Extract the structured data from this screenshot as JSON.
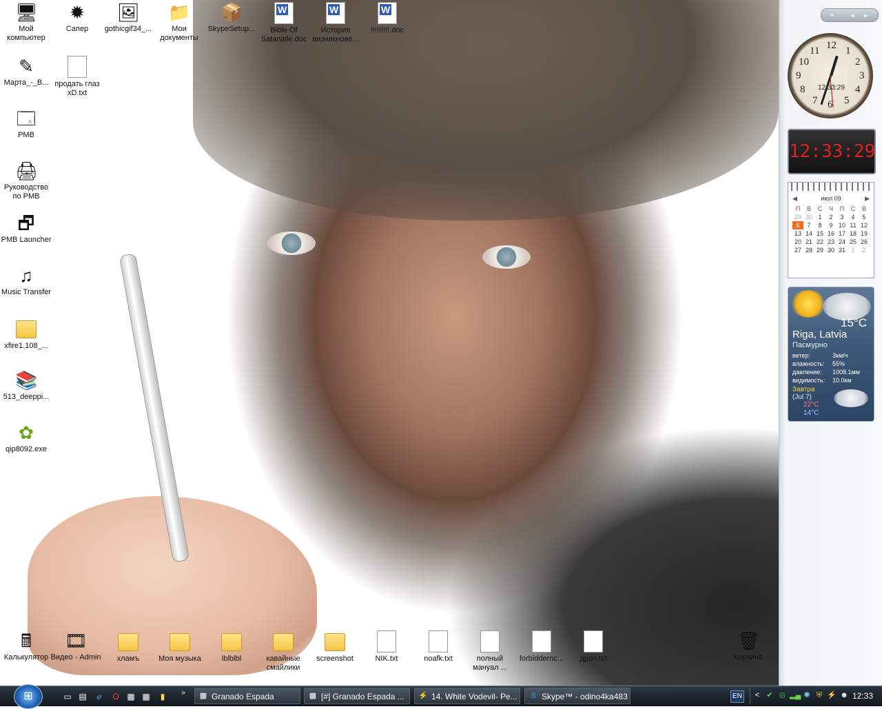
{
  "desktop": {
    "icons_top_row": [
      {
        "label": "Мой компьютер",
        "icon": "computer-icon"
      },
      {
        "label": "Сапер",
        "icon": "minesweeper-icon"
      },
      {
        "label": "gothicgif34_...",
        "icon": "image-file-icon"
      },
      {
        "label": "Мои документы",
        "icon": "documents-folder-icon"
      },
      {
        "label": "SkypeSetup...",
        "icon": "installer-icon"
      },
      {
        "label": "Bible Of Satanaile.doc",
        "icon": "word-doc-icon"
      },
      {
        "label": "История визникнове...",
        "icon": "word-doc-icon"
      },
      {
        "label": "!!!!!!!!!.doc",
        "icon": "word-doc-icon"
      }
    ],
    "icons_left_column": [
      {
        "label": "Марта_-_В...",
        "icon": "shortcut-icon"
      },
      {
        "label": "продать глаз xD.txt",
        "icon": "text-file-icon"
      },
      {
        "label": "PMB",
        "icon": "pmb-icon"
      },
      {
        "label": "Руководство по PMB",
        "icon": "manual-icon"
      },
      {
        "label": "PMB Launcher",
        "icon": "launcher-icon"
      },
      {
        "label": "Music Transfer",
        "icon": "music-transfer-icon"
      },
      {
        "label": "xfire1.108_...",
        "icon": "folder-icon"
      },
      {
        "label": "513_deeppi...",
        "icon": "archive-icon"
      },
      {
        "label": "qip8092.exe",
        "icon": "qip-icon"
      }
    ],
    "icons_bottom_row": [
      {
        "label": "Калькулятор",
        "icon": "calculator-icon"
      },
      {
        "label": "Видео - Admin",
        "icon": "video-folder-icon"
      },
      {
        "label": "хламъ",
        "icon": "folder-icon"
      },
      {
        "label": "Моя музыка",
        "icon": "music-folder-icon"
      },
      {
        "label": "lblblbl",
        "icon": "folder-icon"
      },
      {
        "label": "кавайные смайлики",
        "icon": "folder-icon"
      },
      {
        "label": "screenshot",
        "icon": "folder-icon"
      },
      {
        "label": "NIK.txt",
        "icon": "text-file-icon"
      },
      {
        "label": "noafk.txt",
        "icon": "text-file-icon"
      },
      {
        "label": "полный мануал ...",
        "icon": "text-file-icon"
      },
      {
        "label": "forbiddernc...",
        "icon": "text-file-icon"
      },
      {
        "label": "дроп.txt",
        "icon": "text-file-icon"
      }
    ],
    "recycle_bin": {
      "label": "Корзина",
      "icon": "recycle-bin-icon"
    }
  },
  "sidebar": {
    "toolbar": {
      "add": "+",
      "prev": "◂",
      "next": "▸"
    },
    "clock": {
      "numbers": [
        "12",
        "1",
        "2",
        "3",
        "4",
        "5",
        "6",
        "7",
        "8",
        "9",
        "10",
        "11"
      ],
      "digital": "12:33:29"
    },
    "digital_clock": {
      "time": "12:33:29"
    },
    "calendar": {
      "month": "июл 09",
      "prev": "◀",
      "next": "▶",
      "weekdays": [
        "П",
        "В",
        "С",
        "Ч",
        "П",
        "С",
        "В"
      ],
      "weeks": [
        [
          "29",
          "30",
          "1",
          "2",
          "3",
          "4",
          "5"
        ],
        [
          "6",
          "7",
          "8",
          "9",
          "10",
          "11",
          "12"
        ],
        [
          "13",
          "14",
          "15",
          "16",
          "17",
          "18",
          "19"
        ],
        [
          "20",
          "21",
          "22",
          "23",
          "24",
          "25",
          "26"
        ],
        [
          "27",
          "28",
          "29",
          "30",
          "31",
          "1",
          "2"
        ]
      ],
      "today": "6"
    },
    "weather": {
      "temp": "15°C",
      "city": "Riga, Latvia",
      "condition": "Пасмурно",
      "wind_label": "ветер:",
      "wind": "3км/ч",
      "humidity_label": "влажность:",
      "humidity": "55%",
      "pressure_label": "давление:",
      "pressure": "1008.1мм",
      "visibility_label": "видимость:",
      "visibility": "10.0км",
      "tomorrow_label": "Завтра",
      "tomorrow_date": "(Jul 7)",
      "tomorrow_high": "22°C",
      "tomorrow_low": "14°C"
    }
  },
  "taskbar": {
    "start_icon": "windows-logo-icon",
    "quicklaunch_more": "»",
    "buttons": [
      {
        "label": "Granado Espada",
        "icon": "app-icon"
      },
      {
        "label": "[#] Granado Espada ...",
        "icon": "app-icon"
      },
      {
        "label": "14. White Vodevil- Pe...",
        "icon": "winamp-icon"
      },
      {
        "label": "Skype™ - odino4ka483",
        "icon": "skype-icon"
      }
    ],
    "language": "EN",
    "tray_arrow": "<",
    "time": "12:33"
  },
  "colors": {
    "taskbar": "#1e262e",
    "digital_clock_text": "#e02020",
    "calendar_today": "#f06d1f",
    "weather_bg": "#3e5878"
  }
}
